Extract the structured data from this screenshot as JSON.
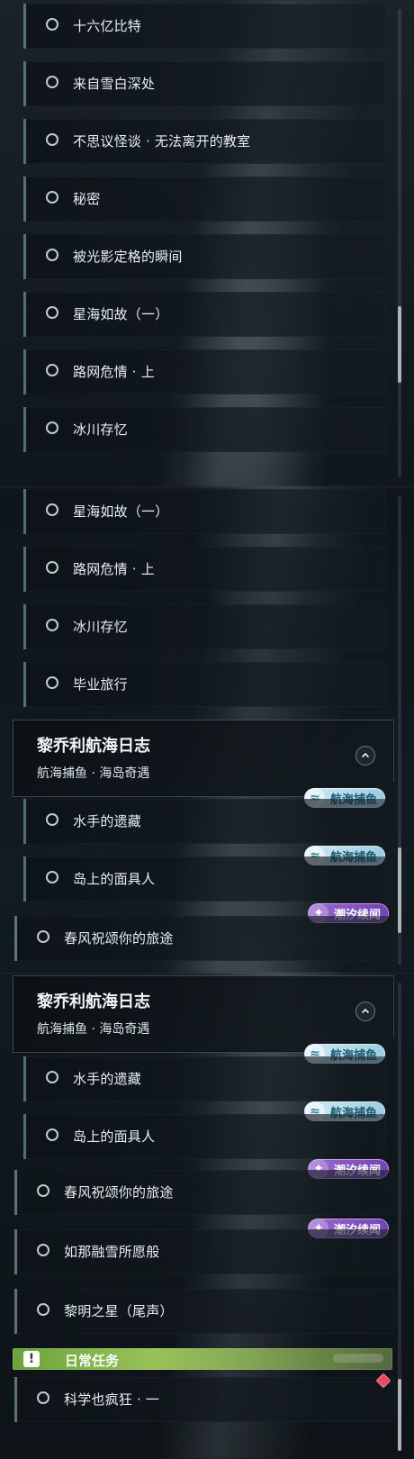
{
  "panels": {
    "top": {
      "items": [
        "十六亿比特",
        "来自雪白深处",
        "不思议怪谈 · 无法离开的教室",
        "秘密",
        "被光影定格的瞬间",
        "星海如故（一）",
        "路网危情 · 上",
        "冰川存忆"
      ]
    },
    "middle": {
      "items_before": [
        "星海如故（一）",
        "路网危情 · 上",
        "冰川存忆",
        "毕业旅行"
      ],
      "section": {
        "title": "黎乔利航海日志",
        "subtitle": "航海捕鱼 · 海岛奇遇"
      },
      "items_after": [
        "水手的遗藏",
        "岛上的面具人",
        "春风祝颂你的旅途"
      ]
    },
    "bottom": {
      "section": {
        "title": "黎乔利航海日志",
        "subtitle": "航海捕鱼 · 海岛奇遇"
      },
      "items": [
        "水手的遗藏",
        "岛上的面具人",
        "春风祝颂你的旅途",
        "如那融雪所愿般",
        "黎明之星（尾声）",
        "科学也疯狂 · 一"
      ],
      "daily": "日常任务"
    }
  },
  "badges": {
    "blue_label": "航海捕鱼",
    "purple_label": "潮汐续闻"
  },
  "icons": {
    "item_status": "circle-outline-icon",
    "collapse": "chevron-up-icon",
    "daily": "exclamation-icon",
    "marker": "diamond-icon",
    "blue_badge": "fishing-wave-icon",
    "purple_badge": "tide-news-icon"
  },
  "colors": {
    "blue_badge": "#bfe8f7",
    "purple_badge": "#8b55cf",
    "daily_bar": "#9ccf5d",
    "marker": "#e64961"
  }
}
